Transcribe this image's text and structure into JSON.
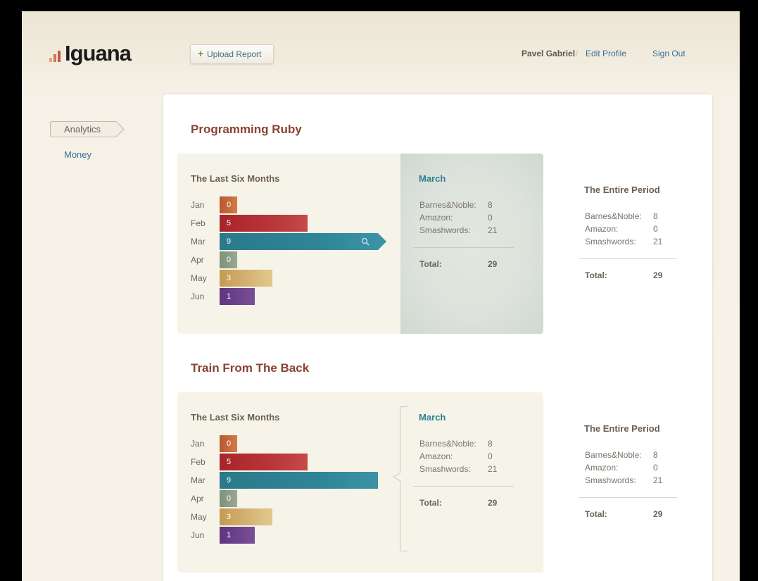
{
  "app": {
    "logo_text": "Iguana"
  },
  "header": {
    "upload_label": "Upload Report",
    "user_name": "Pavel Gabriel",
    "separator": "/",
    "edit_profile": "Edit Profile",
    "sign_out": "Sign Out"
  },
  "sidebar": {
    "items": [
      {
        "label": "Analytics",
        "active": true
      },
      {
        "label": "Money",
        "active": false
      }
    ]
  },
  "colors": {
    "Jan": "#c56a3b",
    "Feb": "#a8242a",
    "Mar": "#2e8496",
    "Apr": "#8a9a84",
    "May": "#c9a25a",
    "Jun": "#6a3d8a",
    "title": "#8b4234",
    "link": "#3b6f95"
  },
  "reports": [
    {
      "title": "Programming Ruby",
      "six_months_title": "The Last Six Months",
      "months": [
        {
          "label": "Jan",
          "value": "0"
        },
        {
          "label": "Feb",
          "value": "5"
        },
        {
          "label": "Mar",
          "value": "9"
        },
        {
          "label": "Apr",
          "value": "0"
        },
        {
          "label": "May",
          "value": "3"
        },
        {
          "label": "Jun",
          "value": "1"
        }
      ],
      "selected": {
        "title": "March",
        "rows": [
          {
            "label": "Barnes&Noble:",
            "value": "8"
          },
          {
            "label": "Amazon:",
            "value": "0"
          },
          {
            "label": "Smashwords:",
            "value": "21"
          }
        ],
        "total_label": "Total:",
        "total_value": "29"
      },
      "entire": {
        "title": "The Entire Period",
        "rows": [
          {
            "label": "Barnes&Noble:",
            "value": "8"
          },
          {
            "label": "Amazon:",
            "value": "0"
          },
          {
            "label": "Smashwords:",
            "value": "21"
          }
        ],
        "total_label": "Total:",
        "total_value": "29"
      }
    },
    {
      "title": "Train From The Back",
      "six_months_title": "The Last Six Months",
      "months": [
        {
          "label": "Jan",
          "value": "0"
        },
        {
          "label": "Feb",
          "value": "5"
        },
        {
          "label": "Mar",
          "value": "9"
        },
        {
          "label": "Apr",
          "value": "0"
        },
        {
          "label": "May",
          "value": "3"
        },
        {
          "label": "Jun",
          "value": "1"
        }
      ],
      "selected": {
        "title": "March",
        "rows": [
          {
            "label": "Barnes&Noble:",
            "value": "8"
          },
          {
            "label": "Amazon:",
            "value": "0"
          },
          {
            "label": "Smashwords:",
            "value": "21"
          }
        ],
        "total_label": "Total:",
        "total_value": "29"
      },
      "entire": {
        "title": "The Entire Period",
        "rows": [
          {
            "label": "Barnes&Noble:",
            "value": "8"
          },
          {
            "label": "Amazon:",
            "value": "0"
          },
          {
            "label": "Smashwords:",
            "value": "21"
          }
        ],
        "total_label": "Total:",
        "total_value": "29"
      }
    }
  ]
}
